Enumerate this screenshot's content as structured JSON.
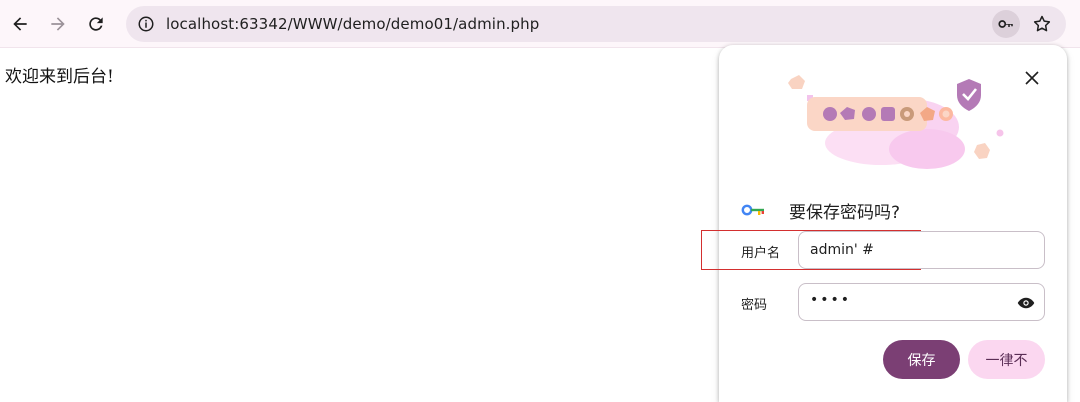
{
  "browser": {
    "url": "localhost:63342/WWW/demo/demo01/admin.php",
    "back_icon": "arrow-left-icon",
    "forward_icon": "arrow-right-icon",
    "reload_icon": "reload-icon",
    "info_icon": "site-info-icon",
    "key_icon": "key-icon",
    "star_icon": "star-icon"
  },
  "page": {
    "message": "欢迎来到后台!"
  },
  "password_prompt": {
    "title": "要保存密码吗?",
    "username_label": "用户名",
    "username_value": "admin' #",
    "password_label": "密码",
    "password_masked": "••••",
    "save_label": "保存",
    "never_label": "一律不",
    "close_icon": "close-icon",
    "eye_icon": "eye-icon"
  },
  "colors": {
    "save_button": "#7b3f74",
    "never_button": "#fbd7f0",
    "highlight_box": "#d32f2f",
    "omnibox": "#efe5ee"
  }
}
